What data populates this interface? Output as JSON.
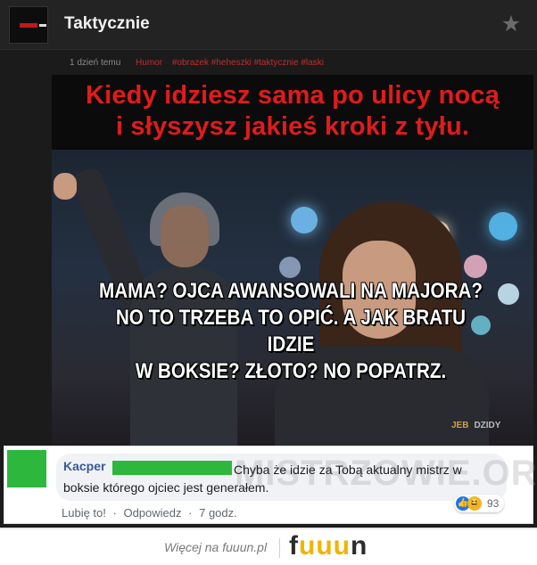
{
  "header": {
    "title": "Taktycznie",
    "favorite_icon": "star-icon"
  },
  "meta": {
    "time": "1 dzień temu",
    "category": "Humor",
    "tags": "#obrazek #heheszki #taktycznie #laski"
  },
  "image": {
    "caption_top_line1": "Kiedy idziesz sama po ulicy nocą",
    "caption_top_line2": "i słyszysz jakieś kroki z tyłu.",
    "caption_bottom_line1": "MAMA? OJCA AWANSOWALI NA MAJORA?",
    "caption_bottom_line2": "NO TO TRZEBA TO OPIĆ. A JAK BRATU IDZIE",
    "caption_bottom_line3": "W BOKSIE? ZŁOTO? NO POPATRZ.",
    "watermark_small_1": "JEB",
    "watermark_small_2": "DZIDY"
  },
  "comment": {
    "author": "Kacper",
    "text": "Chyba że idzie za Tobą aktualny mistrz w boksie którego ojciec jest generałem.",
    "watermark": "MISTRZOWIE.ORG",
    "like_label": "Lubię to!",
    "reply_label": "Odpowiedz",
    "time": "7 godz.",
    "reaction_count": "93",
    "separator": "·"
  },
  "footer": {
    "more_text": "Więcej na fuuun.pl",
    "logo": "fuuun"
  },
  "colors": {
    "brand_green": "#2db83d",
    "accent_red": "#c52b2b",
    "fb_blue": "#385898",
    "logo_yellow": "#f2b300"
  }
}
